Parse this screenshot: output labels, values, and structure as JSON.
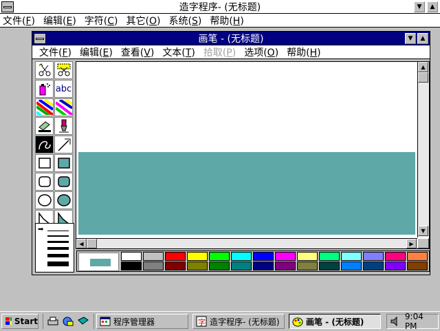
{
  "outer_window": {
    "title": "造字程序- (无标题)",
    "menu": [
      {
        "label": "文件(",
        "key": "F",
        "suffix": ")"
      },
      {
        "label": "编辑(",
        "key": "E",
        "suffix": ")"
      },
      {
        "label": "字符(",
        "key": "C",
        "suffix": ")"
      },
      {
        "label": "其它(",
        "key": "O",
        "suffix": ")"
      },
      {
        "label": "系统(",
        "key": "S",
        "suffix": ")"
      },
      {
        "label": "帮助(",
        "key": "H",
        "suffix": ")"
      }
    ]
  },
  "paint_window": {
    "title": "画笔 - (无标题)",
    "menu": [
      {
        "label": "文件(",
        "key": "F",
        "suffix": ")",
        "disabled": false
      },
      {
        "label": "编辑(",
        "key": "E",
        "suffix": ")",
        "disabled": false
      },
      {
        "label": "查看(",
        "key": "V",
        "suffix": ")",
        "disabled": false
      },
      {
        "label": "文本(",
        "key": "T",
        "suffix": ")",
        "disabled": false
      },
      {
        "label": "拾取(",
        "key": "P",
        "suffix": ")",
        "disabled": true
      },
      {
        "label": "选项(",
        "key": "O",
        "suffix": ")",
        "disabled": false
      },
      {
        "label": "帮助(",
        "key": "H",
        "suffix": ")",
        "disabled": false
      }
    ],
    "text_tool_label": "abc",
    "fill_color": "#5fa8a8",
    "current_color": "#5fa8a8",
    "palette_top": [
      "#ffffff",
      "#c0c0c0",
      "#ff0000",
      "#ffff00",
      "#00ff00",
      "#00ffff",
      "#0000ff",
      "#ff00ff",
      "#ffff80",
      "#00ff80",
      "#80ffff",
      "#8080ff",
      "#ff0080",
      "#ff8040"
    ],
    "palette_bottom": [
      "#000000",
      "#808080",
      "#800000",
      "#808000",
      "#008000",
      "#008080",
      "#000080",
      "#800080",
      "#808040",
      "#004040",
      "#0080ff",
      "#004080",
      "#8000ff",
      "#804000"
    ]
  },
  "taskbar": {
    "start_label": "Start",
    "tasks": [
      {
        "label": "程序管理器",
        "pressed": false
      },
      {
        "label": "造字程序- (无标题)",
        "pressed": false
      },
      {
        "label": "画笔 - (无标题)",
        "pressed": true
      }
    ],
    "clock": "9:04 PM"
  }
}
